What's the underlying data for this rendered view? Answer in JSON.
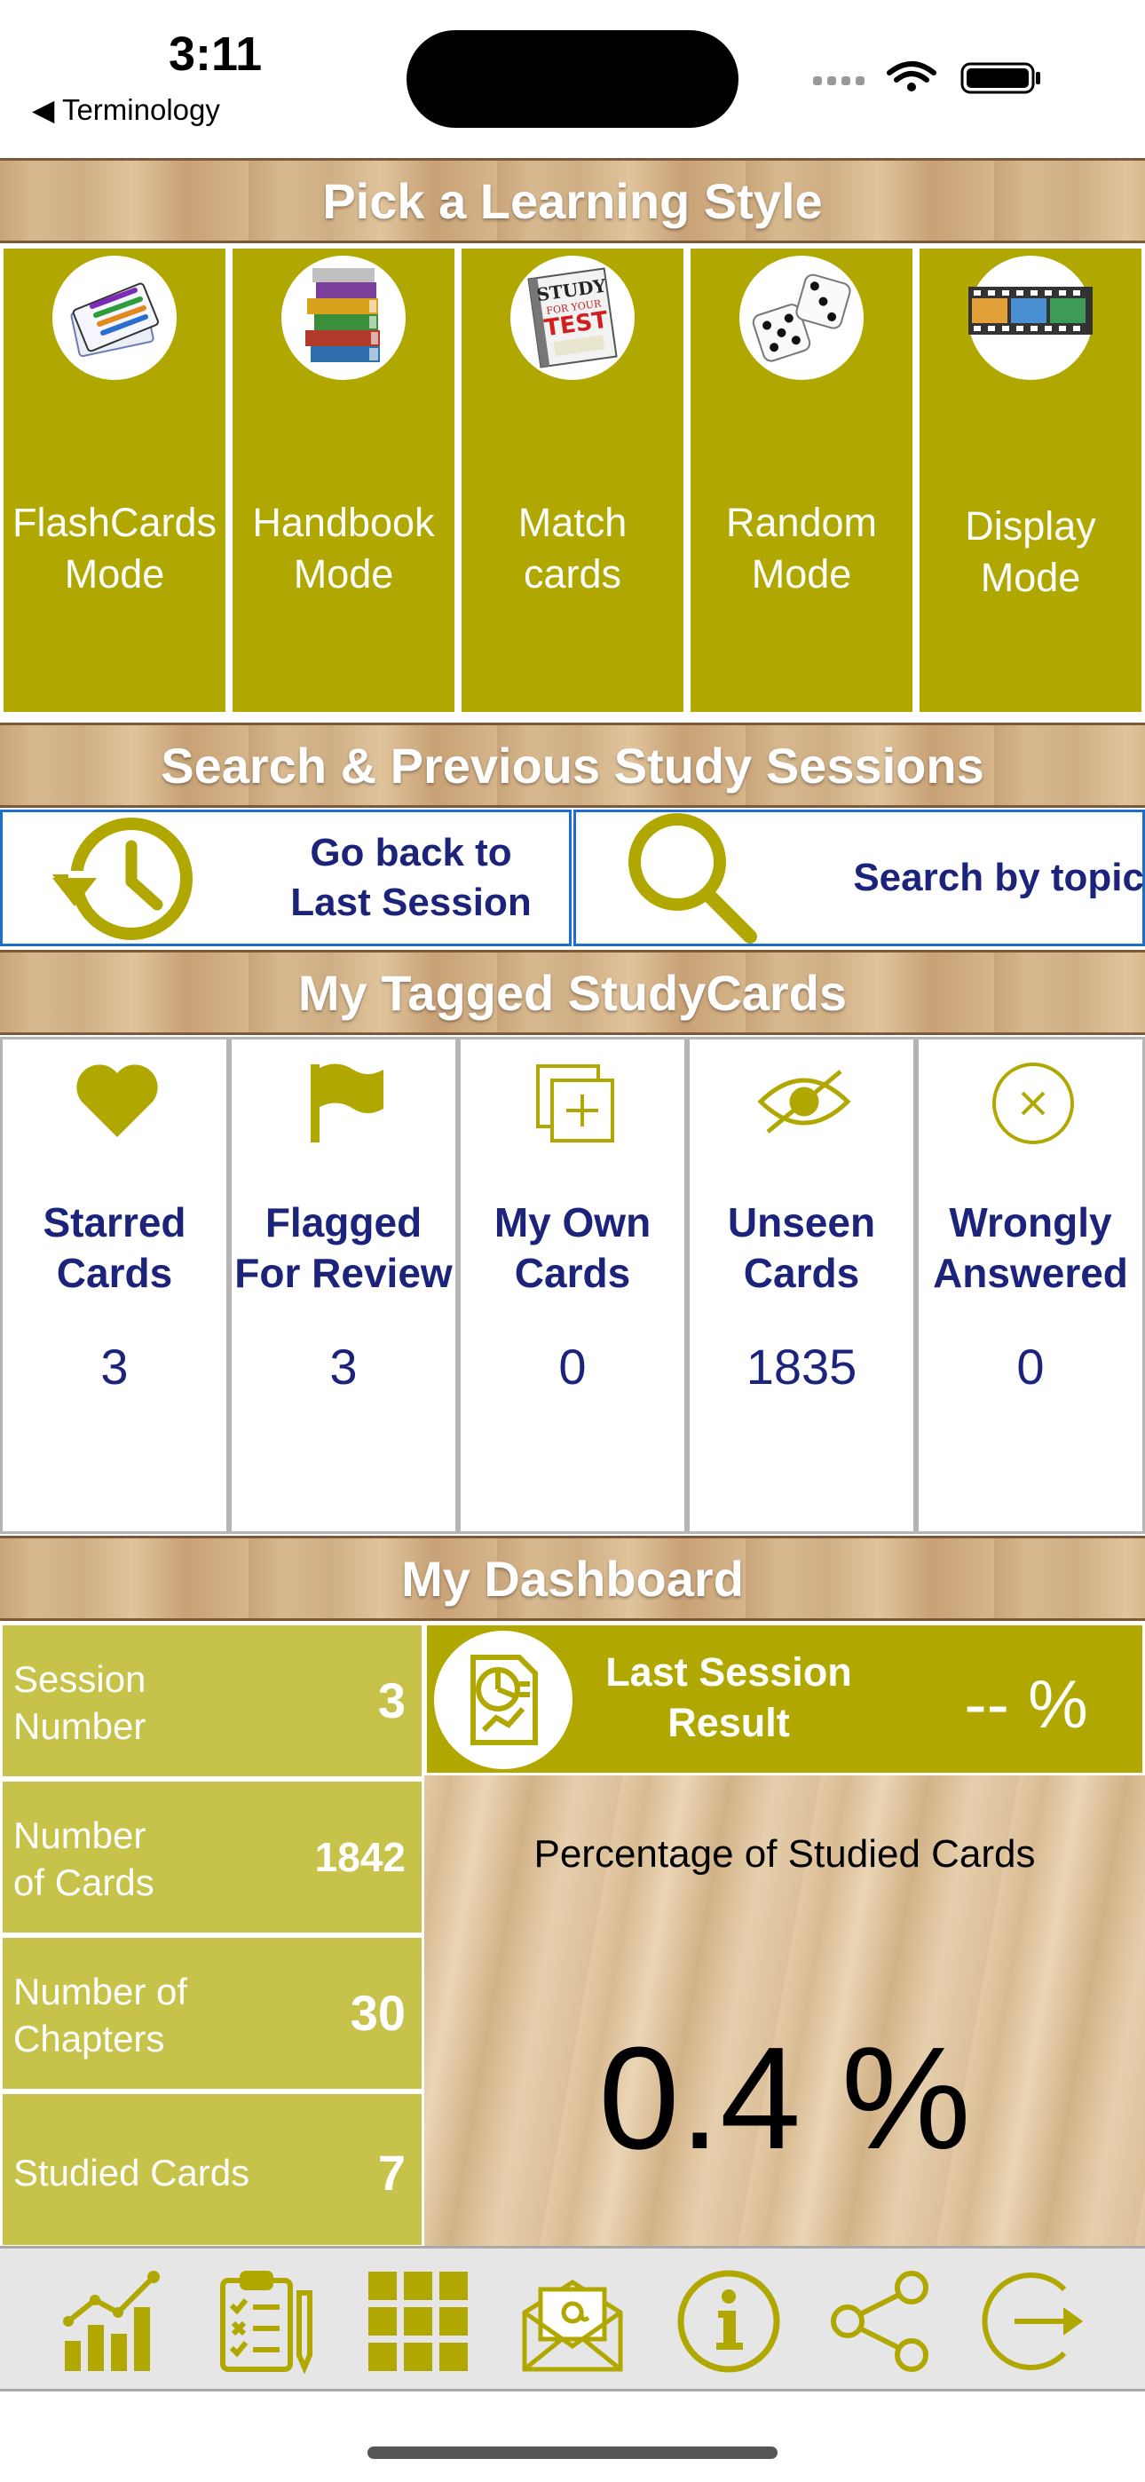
{
  "status_bar": {
    "time": "3:11",
    "back_label": "◀ Terminology"
  },
  "sections": {
    "learning_style": "Pick a Learning Style",
    "search_sessions": "Search & Previous Study Sessions",
    "tagged": "My Tagged StudyCards",
    "dashboard": "My Dashboard"
  },
  "learning_modes": [
    {
      "line1": "FlashCards",
      "line2": "Mode",
      "icon": "flashcards-icon"
    },
    {
      "line1": "Handbook",
      "line2": "Mode",
      "icon": "books-icon"
    },
    {
      "line1": "Match",
      "line2": "cards",
      "icon": "study-test-icon"
    },
    {
      "line1": "Random",
      "line2": "Mode",
      "icon": "dice-icon"
    },
    {
      "line1": "Display",
      "line2": "Mode",
      "icon": "film-icon"
    }
  ],
  "session_buttons": {
    "last_session_line1": "Go back to",
    "last_session_line2": "Last Session",
    "search": "Search by topic"
  },
  "tagged_cards": [
    {
      "line1": "Starred",
      "line2": "Cards",
      "count": "3",
      "icon": "heart-icon"
    },
    {
      "line1": "Flagged",
      "line2": "For Review",
      "count": "3",
      "icon": "flag-icon"
    },
    {
      "line1": "My Own",
      "line2": "Cards",
      "count": "0",
      "icon": "add-card-icon"
    },
    {
      "line1": "Unseen",
      "line2": "Cards",
      "count": "1835",
      "icon": "eye-slash-icon"
    },
    {
      "line1": "Wrongly",
      "line2": "Answered",
      "count": "0",
      "icon": "x-circle-icon"
    }
  ],
  "dashboard": {
    "stats": [
      {
        "line1": "Session",
        "line2": "Number",
        "value": "3"
      },
      {
        "line1": "Number",
        "line2": "of Cards",
        "value": "1842"
      },
      {
        "line1": "Number of",
        "line2": "Chapters",
        "value": "30"
      },
      {
        "line1": "Studied Cards",
        "line2": "",
        "value": "7"
      }
    ],
    "last_session_line1": "Last Session",
    "last_session_line2": "Result",
    "last_session_value": "-- %",
    "studied_title": "Percentage of Studied Cards",
    "studied_value": "0.4 %"
  },
  "bottom_nav": [
    "chart-icon",
    "checklist-icon",
    "grid-icon",
    "email-icon",
    "info-icon",
    "share-icon",
    "exit-icon"
  ],
  "colors": {
    "olive": "#b0a800",
    "olive_light": "#c6c24a",
    "navy": "#1b237b",
    "blue_border": "#1a6fd0"
  }
}
